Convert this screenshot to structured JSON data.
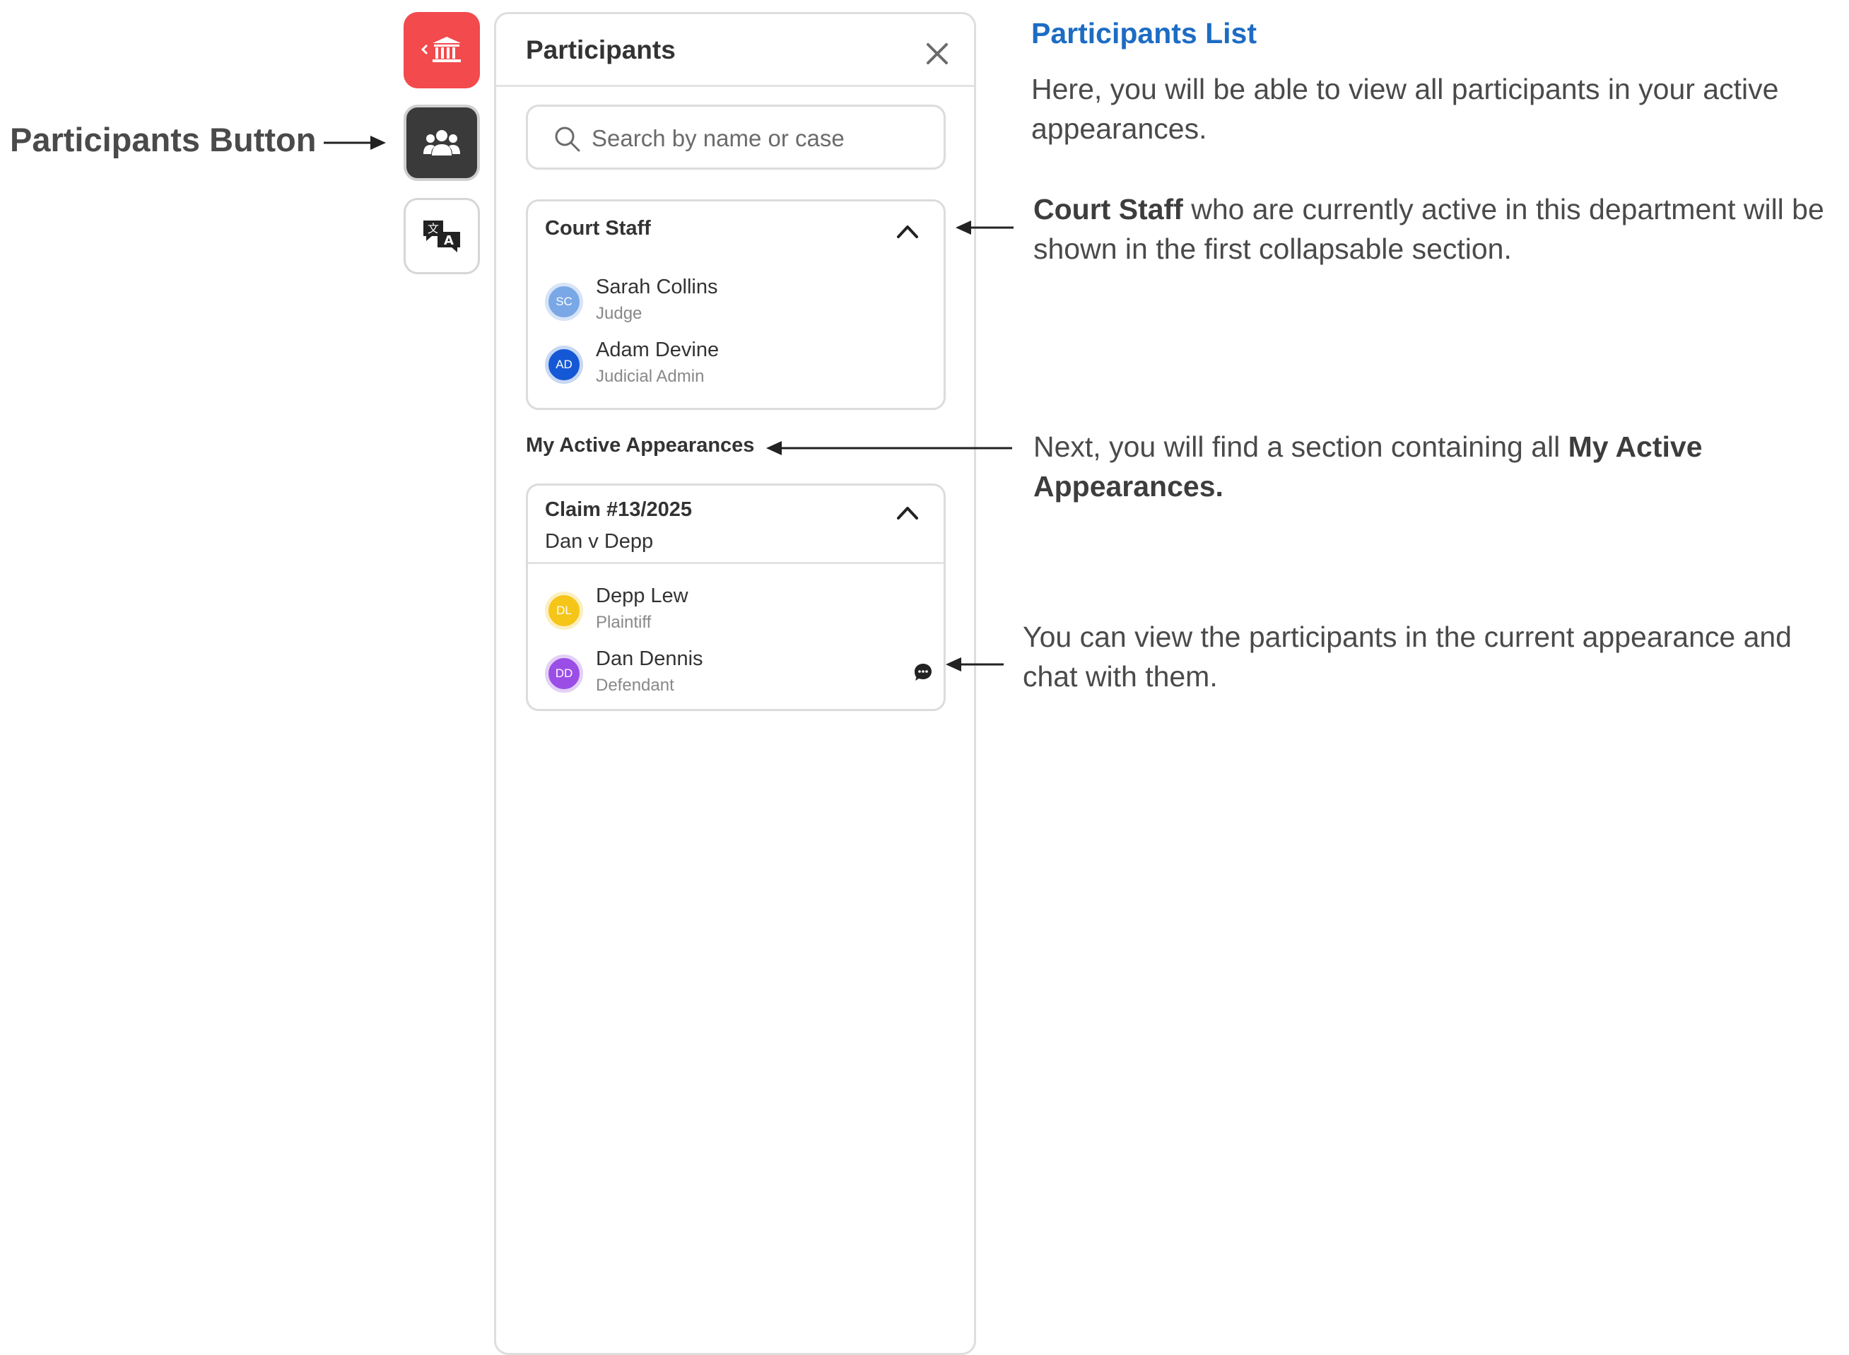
{
  "annotations": {
    "participants_button_label": "Participants Button",
    "list_heading": "Participants List",
    "intro_text": "Here, you will be able to view all participants in your active appearances.",
    "court_staff_bold": "Court Staff",
    "court_staff_rest": " who are currently active in this department will be shown in the first collapsable section.",
    "appearances_lead": "Next, you will find a section containing all ",
    "appearances_bold": "My Active Appearances.",
    "chat_text": "You can view the participants in the current appearance and chat with them."
  },
  "rail": {
    "items": [
      {
        "icon": "courthouse-icon",
        "active": false
      },
      {
        "icon": "participants-icon",
        "active": true
      },
      {
        "icon": "translate-icon",
        "active": false
      }
    ]
  },
  "panel": {
    "title": "Participants",
    "search_placeholder": "Search by name or case",
    "court_staff": {
      "title": "Court Staff",
      "members": [
        {
          "initials": "SC",
          "name": "Sarah Collins",
          "role": "Judge"
        },
        {
          "initials": "AD",
          "name": "Adam Devine",
          "role": "Judicial Admin"
        }
      ]
    },
    "appearances_label": "My Active Appearances",
    "claim": {
      "title": "Claim #13/2025",
      "subtitle": "Dan v Depp",
      "members": [
        {
          "initials": "DL",
          "name": "Depp Lew",
          "role": "Plaintiff"
        },
        {
          "initials": "DD",
          "name": "Dan Dennis",
          "role": "Defendant"
        }
      ]
    }
  },
  "colors": {
    "accent_red": "#f24a4d",
    "heading_blue": "#1d6cc4",
    "avatar_sc": "#7aa7e6",
    "avatar_ad": "#1558d6",
    "avatar_dl": "#f5c518",
    "avatar_dd": "#9b4ee6"
  }
}
